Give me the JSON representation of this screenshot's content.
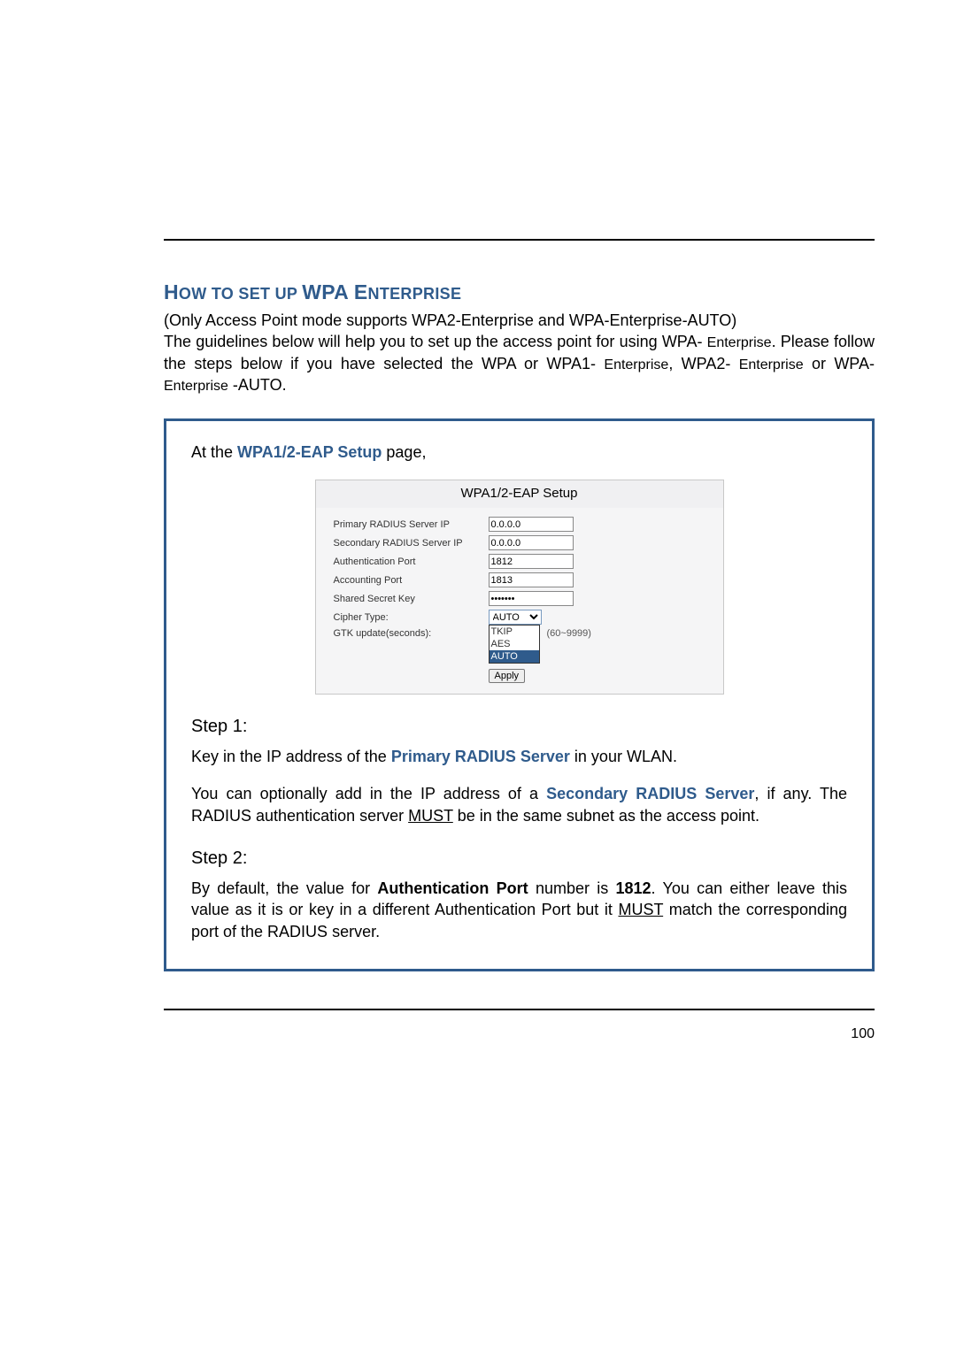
{
  "heading": {
    "prefix": "H",
    "t1": "OW TO SET UP ",
    "mid": "WPA E",
    "t2": "NTERPRISE"
  },
  "intro": {
    "line1": "(Only Access Point mode supports WPA2-Enterprise and WPA-Enterprise-AUTO)",
    "line2a": "The guidelines below will help you to set up the access point for using WPA- ",
    "line2b": "Enterprise",
    "line2c": ". Please follow the steps below if you have selected the WPA or WPA1- ",
    "line2d": "Enterprise",
    "line2e": ", WPA2- ",
    "line2f": "Enterprise",
    "line2g": " or WPA- ",
    "line2h": "Enterprise",
    "line2i": " -AUTO."
  },
  "atline": {
    "pre": "At the ",
    "link": "WPA1/2-EAP Setup",
    "post": " page,"
  },
  "panel": {
    "title": "WPA1/2-EAP Setup",
    "rows": {
      "primary": {
        "label": "Primary RADIUS Server IP",
        "value": "0.0.0.0"
      },
      "secondary": {
        "label": "Secondary RADIUS Server IP",
        "value": "0.0.0.0"
      },
      "authport": {
        "label": "Authentication Port",
        "value": "1812"
      },
      "acctport": {
        "label": "Accounting Port",
        "value": "1813"
      },
      "sharedkey": {
        "label": "Shared Secret Key",
        "value": "•••••••"
      },
      "cipher": {
        "label": "Cipher Type:",
        "selected": "AUTO",
        "opt1": "TKIP",
        "opt2": "AES",
        "opt3": "AUTO"
      },
      "gtk": {
        "label": "GTK update(seconds):",
        "hint": "(60~9999)"
      }
    },
    "apply": "Apply"
  },
  "step1": {
    "title": "Step 1:",
    "p1a": "Key in the IP address of the ",
    "p1b": "Primary RADIUS Server",
    "p1c": " in your WLAN.",
    "p2a": "You can optionally add in the IP address of a ",
    "p2b": "Secondary RADIUS Server",
    "p2c": ", if any. The RADIUS authentication server ",
    "p2d": "MUST",
    "p2e": " be in the same subnet as the access point."
  },
  "step2": {
    "title": "Step 2:",
    "p1a": "By default, the value for ",
    "p1b": "Authentication Port",
    "p1c": " number is ",
    "p1d": "1812",
    "p1e": ". You can either leave this value as it is or key in a different Authentication Port but it ",
    "p1f": "MUST",
    "p1g": " match the corresponding port of the RADIUS server."
  },
  "pagenum": "100"
}
